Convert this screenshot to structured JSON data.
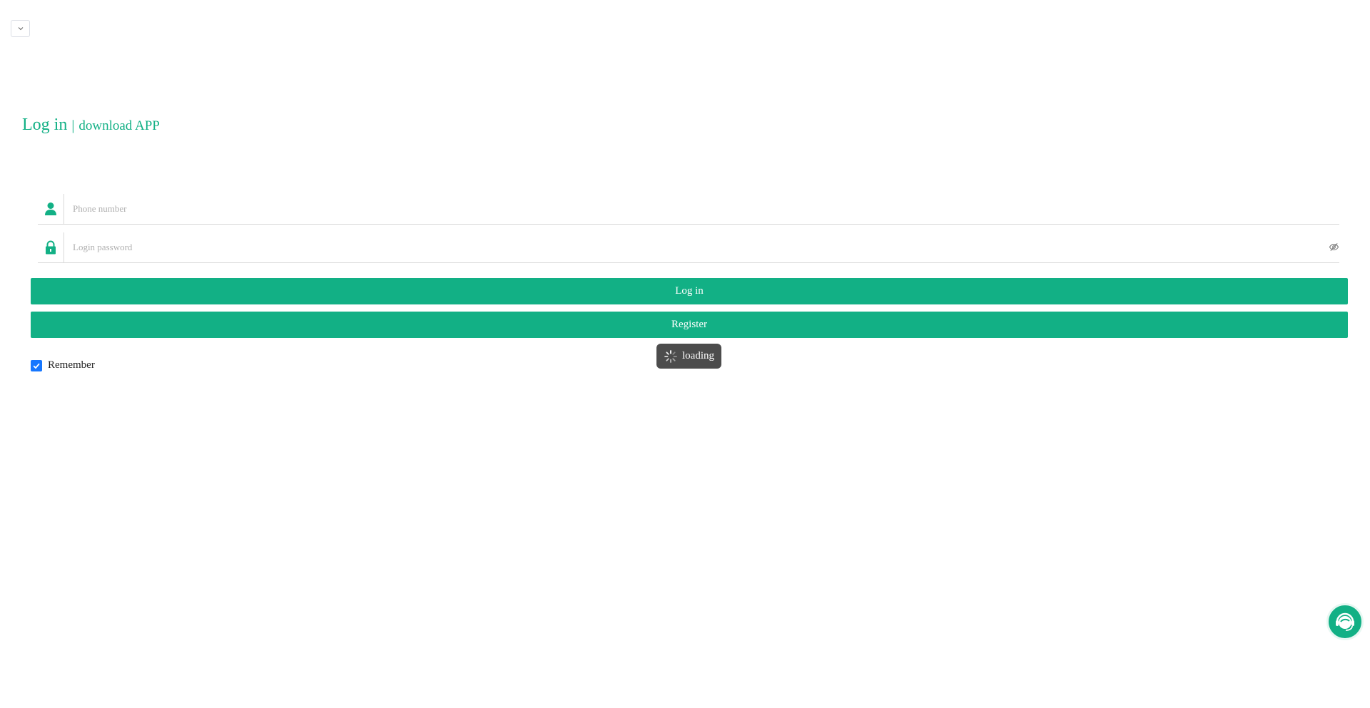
{
  "header": {
    "language_dropdown_icon": "chevron-down-icon"
  },
  "title": {
    "login": "Log in",
    "separator": "|",
    "download": "download APP"
  },
  "form": {
    "phone_placeholder": "Phone number",
    "phone_icon": "user-icon",
    "password_placeholder": "Login password",
    "password_icon": "lock-icon",
    "password_toggle_icon": "eye-off-icon",
    "login_label": "Log in",
    "register_label": "Register",
    "remember_label": "Remember",
    "remember_checked": true
  },
  "toast": {
    "text": "loading"
  },
  "support": {
    "icon": "customer-service-icon"
  },
  "colors": {
    "accent": "#12b085",
    "checkbox": "#1677ff",
    "toast_bg": "#4c4c4c"
  }
}
